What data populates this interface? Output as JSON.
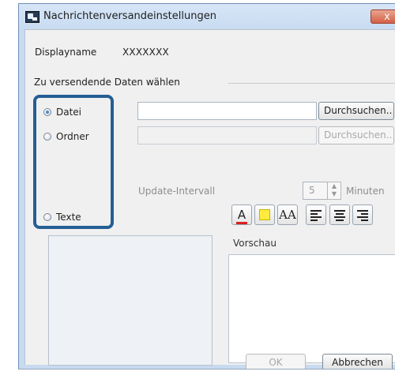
{
  "window": {
    "title": "Nachrichtenversandeinstellungen",
    "close_label": "x"
  },
  "display": {
    "label": "Displayname",
    "value": "XXXXXXX"
  },
  "data_selection": {
    "group_title": "Zu versendende Daten wählen",
    "options": [
      {
        "label": "Datei",
        "checked": true
      },
      {
        "label": "Ordner",
        "checked": false
      },
      {
        "label": "Texte",
        "checked": false
      }
    ],
    "file_value": "",
    "folder_value": "",
    "file_browse_label": "Durchsuchen..",
    "folder_browse_label": "Durchsuchen..",
    "update_interval_label": "Update-Intervall",
    "update_interval_value": "5",
    "minutes_label": "Minuten"
  },
  "text_toolbar": {
    "font_color_glyph": "A",
    "font_size_glyph": "AA",
    "colors": {
      "font_color": "#d92020",
      "background_color": "#ffec3d"
    },
    "icons": [
      "font-color-icon",
      "background-color-icon",
      "font-size-icon",
      "align-left-icon",
      "align-center-icon",
      "align-right-icon"
    ]
  },
  "preview": {
    "label": "Vorschau"
  },
  "buttons": {
    "ok": "OK",
    "cancel": "Abbrechen"
  },
  "colors": {
    "selection_highlight": "#245f94",
    "window_frame": "#c8dbf1"
  }
}
